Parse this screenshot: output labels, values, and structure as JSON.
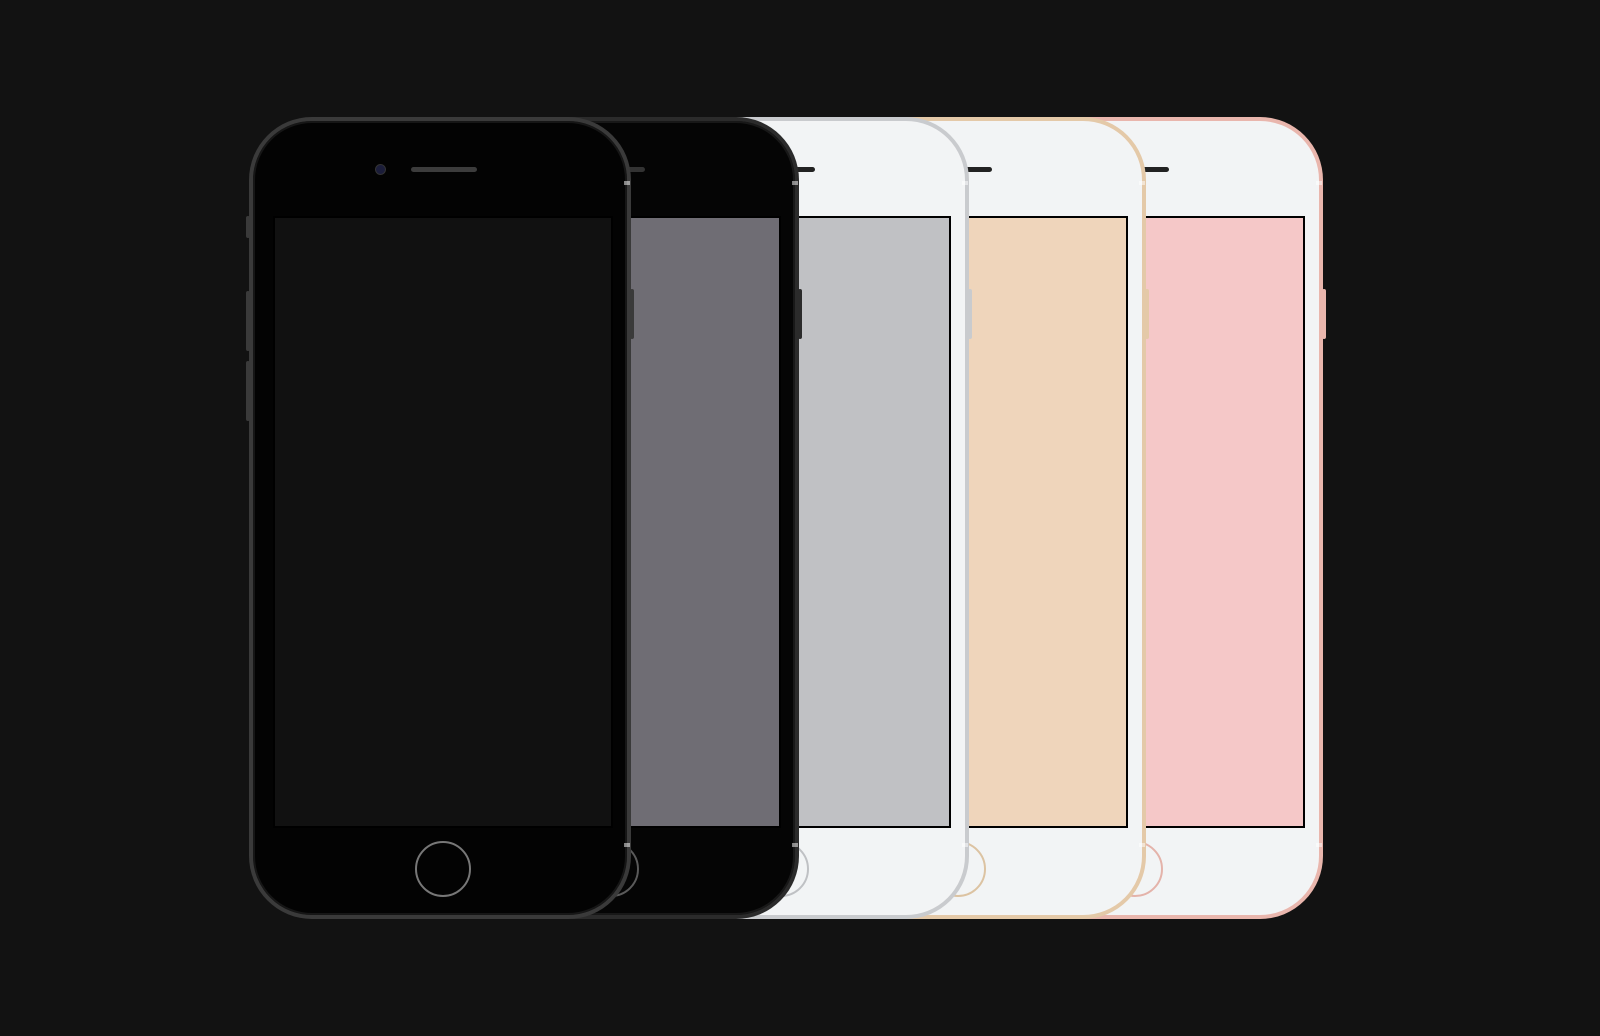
{
  "background": "#121212",
  "phones": [
    {
      "name": "rose-gold",
      "body": "#f2f4f5",
      "rim": "#e9b6ad",
      "screen": "#f5c8c8",
      "trim": "#222222",
      "home_ring": "#e4b3aa"
    },
    {
      "name": "gold",
      "body": "#f2f4f5",
      "rim": "#e4c9a8",
      "screen": "#efd5bb",
      "trim": "#222222",
      "home_ring": "#dcc3a2"
    },
    {
      "name": "silver",
      "body": "#f2f4f5",
      "rim": "#c9cbce",
      "screen": "#c0c1c4",
      "trim": "#222222",
      "home_ring": "#bfc1c4"
    },
    {
      "name": "space-gray",
      "body": "#050505",
      "rim": "#2b2b2b",
      "screen": "#6f6d74",
      "trim": "#333333",
      "home_ring": "#5a5a5a"
    },
    {
      "name": "jet-black",
      "body": "#030303",
      "rim": "#3a3a3a",
      "screen": "#111111",
      "trim": "#3c3c3c",
      "home_ring": "#777777"
    }
  ]
}
